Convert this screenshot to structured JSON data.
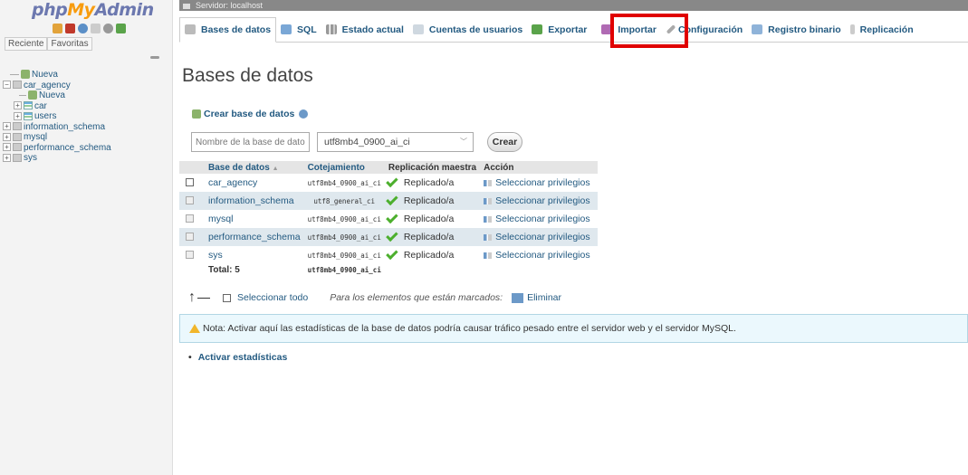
{
  "sidebar": {
    "logo": {
      "php": "php",
      "my": "My",
      "admin": "Admin"
    },
    "quick_icons": [
      "home-icon",
      "logout-icon",
      "help-icon",
      "docs-icon",
      "settings-icon",
      "reload-icon"
    ],
    "tabs": [
      "Reciente",
      "Favoritas"
    ],
    "tree": [
      {
        "label": "Nueva",
        "type": "new",
        "level": 1
      },
      {
        "label": "car_agency",
        "type": "db",
        "level": 0
      },
      {
        "label": "Nueva",
        "type": "new",
        "level": 2
      },
      {
        "label": "car",
        "type": "table",
        "level": 1
      },
      {
        "label": "users",
        "type": "table",
        "level": 1
      },
      {
        "label": "information_schema",
        "type": "db",
        "level": 0
      },
      {
        "label": "mysql",
        "type": "db",
        "level": 0
      },
      {
        "label": "performance_schema",
        "type": "db",
        "level": 0
      },
      {
        "label": "sys",
        "type": "db",
        "level": 0
      }
    ]
  },
  "serverbar": {
    "label": "Servidor: localhost"
  },
  "topmenu": {
    "tabs": [
      {
        "label": "Bases de datos",
        "icon": "database-icon",
        "active": true
      },
      {
        "label": "SQL",
        "icon": "sql-icon",
        "active": false
      },
      {
        "label": "Estado actual",
        "icon": "status-icon",
        "active": false
      },
      {
        "label": "Cuentas de usuarios",
        "icon": "users-icon",
        "active": false
      },
      {
        "label": "Exportar",
        "icon": "export-icon",
        "active": false
      },
      {
        "label": "Importar",
        "icon": "import-icon",
        "active": false
      },
      {
        "label": "Configuración",
        "icon": "settings-icon",
        "active": false
      },
      {
        "label": "Registro binario",
        "icon": "binlog-icon",
        "active": false
      },
      {
        "label": "Replicación",
        "icon": "replication-icon",
        "active": false
      }
    ]
  },
  "main": {
    "title": "Bases de datos",
    "create_db": {
      "label": "Crear base de datos",
      "name_placeholder": "Nombre de la base de dato",
      "collation": "utf8mb4_0900_ai_ci",
      "button": "Crear"
    },
    "table": {
      "headers": {
        "name": "Base de datos",
        "sort_indicator": "▲",
        "collation": "Cotejamiento",
        "replication": "Replicación maestra",
        "action": "Acción"
      },
      "rows": [
        {
          "name": "car_agency",
          "collation": "utf8mb4_0900_ai_ci",
          "replication": "Replicado/a",
          "action": "Seleccionar privilegios"
        },
        {
          "name": "information_schema",
          "collation": "utf8_general_ci",
          "replication": "Replicado/a",
          "action": "Seleccionar privilegios"
        },
        {
          "name": "mysql",
          "collation": "utf8mb4_0900_ai_ci",
          "replication": "Replicado/a",
          "action": "Seleccionar privilegios"
        },
        {
          "name": "performance_schema",
          "collation": "utf8mb4_0900_ai_ci",
          "replication": "Replicado/a",
          "action": "Seleccionar privilegios"
        },
        {
          "name": "sys",
          "collation": "utf8mb4_0900_ai_ci",
          "replication": "Replicado/a",
          "action": "Seleccionar privilegios"
        }
      ],
      "total_label": "Total: 5",
      "total_collation": "utf8mb4_0900_ai_ci"
    },
    "bulk": {
      "select_all": "Seleccionar todo",
      "for_marked": "Para los elementos que están marcados:",
      "delete": "Eliminar"
    },
    "notice": "Nota: Activar aquí las estadísticas de la base de datos podría causar tráfico pesado entre el servidor web y el servidor MySQL.",
    "activate_stats": "Activar estadísticas"
  },
  "colors": {
    "link": "#235a81",
    "highlight": "#e00000",
    "row_alt": "#dfe8ee"
  }
}
